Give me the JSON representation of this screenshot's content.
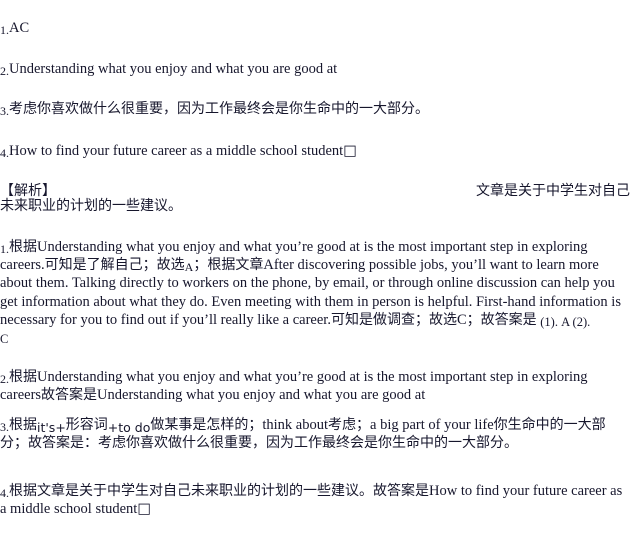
{
  "document": {
    "background_color": "#ffffff",
    "text_color": "#16162c"
  },
  "answers": {
    "items": [
      {
        "index": "1.",
        "text": "AC",
        "script": "latin"
      },
      {
        "index": "2.",
        "text": "Understanding what you enjoy and what you are good at",
        "script": "latin"
      },
      {
        "index": "3.",
        "text": "考虑你喜欢做什么很重要，因为工作最终会是你生命中的一大部分。",
        "script": "cjk"
      },
      {
        "index": "4.",
        "text": "How to find your future career as a middle school student",
        "trailing_glyph": "□",
        "script": "latin"
      }
    ]
  },
  "analysis_header": {
    "label": "【解析】",
    "right_text": "文章是关于中学生对自己",
    "continuation": "未来职业的计划的一些建议。"
  },
  "explanations": {
    "items": [
      {
        "index": "1.",
        "lead_cjk": "根据",
        "quote_1": "Understanding what you enjoy and what you’re good at is the most important step in exploring careers.",
        "mid_cjk_1": "可知是了解自己；故选",
        "choice_1": "A",
        "mid_cjk_2": "；根据文章",
        "quote_2": "After discovering possible jobs, you’ll want to learn more about them. Talking directly to workers on the phone, by email, or through online discussion can help you get information about what they do. Even meeting with them in person is helpful. First-hand information is necessary for you to find out if you’ll really like a career.",
        "mid_cjk_3": "可知是做调查；故选",
        "choice_2": "C",
        "mid_cjk_4": "；故答案是",
        "tail": "(1). A (2).",
        "tail_overflow": "C"
      },
      {
        "index": "2.",
        "lead_cjk": "根据",
        "quote_1": "Understanding what you enjoy and what you’re good at is the most important step in exploring careers",
        "mid_cjk_1": "故答案是",
        "quote_2": "Understanding what you enjoy and what you are good at"
      },
      {
        "index": "3.",
        "lead_cjk": "根据",
        "frag_a": "it's+",
        "frag_b": "形容词",
        "frag_c": "+to do",
        "gloss_a": "做某事是怎样的；",
        "phrase_b": "think about",
        "gloss_b": "考虑；",
        "phrase_c": "a big part of your life",
        "gloss_c": "你生命中的一大部分；故答案是：考虑你喜欢做什么很重要，因为工作最终会是你生命中的一大部分。"
      },
      {
        "index": "4.",
        "lead_cjk": "根据文章是关于中学生对自己未来职业的计划的一些建议。故答案是",
        "quote_1": "How to find your future career as a middle school student",
        "trailing_glyph": "□"
      }
    ]
  }
}
